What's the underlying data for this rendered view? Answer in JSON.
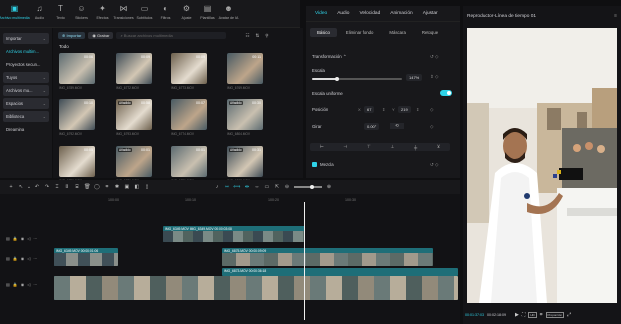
{
  "toolbar": {
    "items": [
      {
        "label": "Archivo multimedia",
        "icon": "media-icon",
        "active": true
      },
      {
        "label": "Audio",
        "icon": "audio-icon"
      },
      {
        "label": "Texto",
        "icon": "text-icon"
      },
      {
        "label": "Stickers",
        "icon": "sticker-icon"
      },
      {
        "label": "Efectos",
        "icon": "effects-icon"
      },
      {
        "label": "Transiciones",
        "icon": "transitions-icon"
      },
      {
        "label": "Subtítulos",
        "icon": "subtitles-icon"
      },
      {
        "label": "Filtros",
        "icon": "filters-icon"
      },
      {
        "label": "Ajuste",
        "icon": "adjust-icon"
      },
      {
        "label": "Plantillas",
        "icon": "templates-icon"
      },
      {
        "label": "Avatar de IA",
        "icon": "ai-avatar-icon"
      }
    ]
  },
  "sidebar": {
    "items": [
      {
        "label": "Importar",
        "chev": "⌄",
        "hl": true
      },
      {
        "label": "Archivos multim...",
        "chev": "",
        "cyan": true
      },
      {
        "label": "Proyectos secun...",
        "chev": ""
      },
      {
        "label": "Tuyos",
        "chev": "⌄",
        "hl": true
      },
      {
        "label": "Archivos mu...",
        "chev": "⌄",
        "hl": true
      },
      {
        "label": "Espacios",
        "chev": "⌄",
        "hl": true
      },
      {
        "label": "Biblioteca",
        "chev": "⌄",
        "hl": true
      },
      {
        "label": "Dreamina",
        "chev": ""
      }
    ]
  },
  "media": {
    "import_label": "Importar",
    "record_label": "Grabar",
    "search_placeholder": "Buscar archivos multimedia",
    "filter_label": "Todo",
    "thumbs": [
      {
        "name": "IMG_6789.MOV",
        "dur": "00:06",
        "badge": ""
      },
      {
        "name": "IMG_6772.MOV",
        "dur": "00:09",
        "badge": ""
      },
      {
        "name": "IMG_6773.MOV",
        "dur": "00:09",
        "badge": ""
      },
      {
        "name": "IMG_6769.MOV",
        "dur": "00:11",
        "badge": ""
      },
      {
        "name": "IMG_6792.MOV",
        "dur": "00:10",
        "badge": ""
      },
      {
        "name": "IMG_6793.MOV",
        "dur": "00:58",
        "badge": "Añadido"
      },
      {
        "name": "IMG_6774.MOV",
        "dur": "00:07",
        "badge": ""
      },
      {
        "name": "IMG_6804.MOV",
        "dur": "00:30",
        "badge": "Añadido"
      },
      {
        "name": "IMG_6750.MOV",
        "dur": "00:05",
        "badge": ""
      },
      {
        "name": "IMG_6776.MOV",
        "dur": "00:01",
        "badge": "Añadido"
      },
      {
        "name": "IMG_6791.MOV",
        "dur": "00:01",
        "badge": ""
      },
      {
        "name": "IMG_6803.MOV",
        "dur": "00:31",
        "badge": "Añadido"
      }
    ]
  },
  "props": {
    "tabs": [
      "Video",
      "Audio",
      "Velocidad",
      "Animación",
      "Ajustar"
    ],
    "subtabs": [
      "Básico",
      "Eliminar fondo",
      "Máscara",
      "Retoque"
    ],
    "transform_label": "Transformación",
    "scale_label": "Escala",
    "scale_value": "147%",
    "scale_level": 0.28,
    "uniform_label": "Escala uniforme",
    "position_label": "Posición",
    "pos_x_label": "X",
    "pos_x": "67",
    "pos_y_label": "Y",
    "pos_y": "219",
    "rotate_label": "Girar",
    "rotate_value": "0.00°",
    "mix_label": "Mezcla"
  },
  "player": {
    "title": "Reproductor-Línea de tiempo 01",
    "time_current": "00:01:37:03",
    "time_total": "00:02:18:09",
    "ratio_label": "Proporción"
  },
  "timeline": {
    "ruler": [
      "100:00",
      "100:10",
      "100:20",
      "100:30"
    ],
    "clips": [
      {
        "name": "IMG_6349.MOV  IMG_6349.MOV  00:00:03:08"
      },
      {
        "name": "IMG_6349.MOV  00:00:01:06"
      },
      {
        "name": "IMG_6875.MOV  00:00:09:09"
      },
      {
        "name": "IMG_6873.MOV  00:00:36:18"
      }
    ]
  },
  "colors": {
    "accent": "#2fd3e8",
    "clip_teal": "#1e6e78",
    "bg": "#0f0f11"
  }
}
